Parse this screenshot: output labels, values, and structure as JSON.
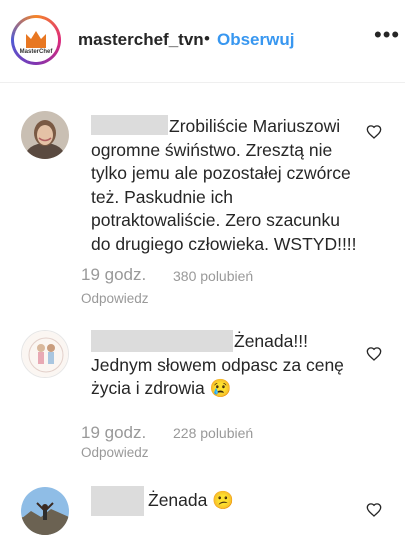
{
  "header": {
    "username": "masterchef_tvn",
    "separator": "•",
    "follow_label": "Obserwuj",
    "more_label": "•••",
    "logo_text": "MasterChef"
  },
  "comments": [
    {
      "text": "Zrobiliście Mariuszowi\nogromne świństwo. Zresztą nie\ntylko jemu ale pozostałej czwórce\nteż. Paskudnie ich\npotraktowaliście. Zero szacunku\ndo drugiego człowieka. WSTYD!!!!",
      "time": "19 godz.",
      "likes": "380 polubień",
      "reply": "Odpowiedz"
    },
    {
      "text": "Żenada!!!\nJednym słowem odpasc za cenę\nżycia i zdrowia 😢",
      "time": "19 godz.",
      "likes": "228 polubień",
      "reply": "Odpowiedz"
    },
    {
      "text": "Żenada 😕"
    }
  ],
  "colors": {
    "accent": "#3897f0",
    "text": "#262626",
    "muted": "#999999",
    "redacted": "#dcdcdc"
  }
}
